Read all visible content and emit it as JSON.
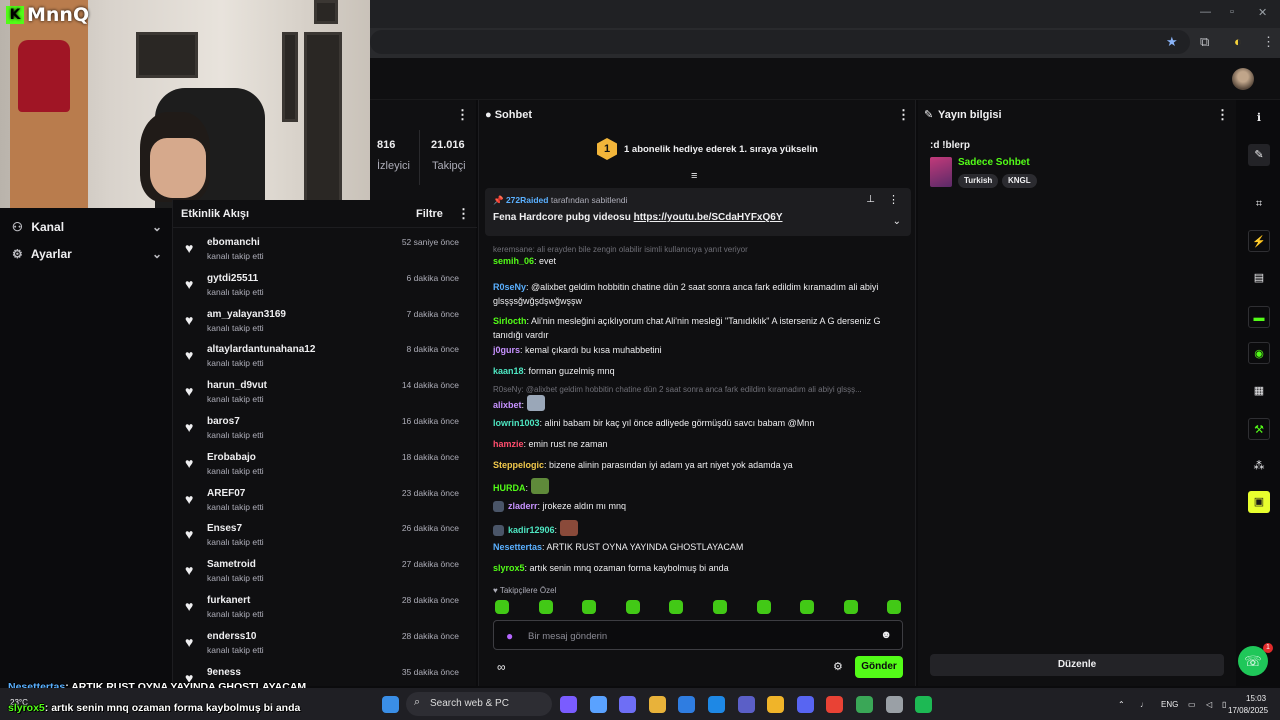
{
  "brand": {
    "logo_text": "MnnQ"
  },
  "stats": {
    "viewers_value": "816",
    "viewers_label": "İzleyici",
    "followers_value": "21.016",
    "followers_label": "Takipçi"
  },
  "left_nav": {
    "items": [
      {
        "label": "Kanal",
        "icon": "user-icon"
      },
      {
        "label": "Ayarlar",
        "icon": "gear-icon"
      }
    ]
  },
  "activity": {
    "title": "Etkinlik Akışı",
    "filter_label": "Filtre",
    "items": [
      {
        "user": "ebomanchi",
        "action": "kanalı takip etti",
        "time": "52 saniye önce"
      },
      {
        "user": "gytdi25511",
        "action": "kanalı takip etti",
        "time": "6 dakika önce"
      },
      {
        "user": "am_yalayan3169",
        "action": "kanalı takip etti",
        "time": "7 dakika önce"
      },
      {
        "user": "altaylardantunahana12",
        "action": "kanalı takip etti",
        "time": "8 dakika önce"
      },
      {
        "user": "harun_d9vut",
        "action": "kanalı takip etti",
        "time": "14 dakika önce"
      },
      {
        "user": "baros7",
        "action": "kanalı takip etti",
        "time": "16 dakika önce"
      },
      {
        "user": "Erobabajo",
        "action": "kanalı takip etti",
        "time": "18 dakika önce"
      },
      {
        "user": "AREF07",
        "action": "kanalı takip etti",
        "time": "23 dakika önce"
      },
      {
        "user": "Enses7",
        "action": "kanalı takip etti",
        "time": "26 dakika önce"
      },
      {
        "user": "Sametroid",
        "action": "kanalı takip etti",
        "time": "27 dakika önce"
      },
      {
        "user": "furkanert",
        "action": "kanalı takip etti",
        "time": "28 dakika önce"
      },
      {
        "user": "enderss10",
        "action": "kanalı takip etti",
        "time": "28 dakika önce"
      },
      {
        "user": "9eness",
        "action": "",
        "time": "35 dakika önce"
      }
    ]
  },
  "chat": {
    "title": "Sohbet",
    "goal_badge": "1",
    "goal_text": "1 abonelik hediye ederek 1. sıraya yükselin",
    "pinned": {
      "user": "272Raided",
      "meta_suffix": "tarafından sabitlendi",
      "text": "Fena Hardcore pubg videosu",
      "link": "https://youtu.be/SCdaHYFxQ6Y"
    },
    "reply_1": "keremsane: ali erayden bile zengin olabilir isimli kullanıcıya yanıt veriyor",
    "reply_2": "R0seNy: @alixbet geldim hobbitin chatine dün 2 saat sonra anca fark edildim kıramadım ali abiyi glsşş...",
    "messages": [
      {
        "user": "semih_06",
        "color": "#53fc18",
        "text": "evet"
      },
      {
        "user": "R0seNy",
        "color": "#5ab0ff",
        "text": "@alixbet geldim hobbitin chatine dün 2 saat sonra anca fark edildim kıramadım ali abiyi glsşşsğwğşdşwğwşşw"
      },
      {
        "user": "Sirlocth",
        "color": "#53fc18",
        "text": "Ali'nin mesleğini açıklıyorum chat Ali'nin mesleği \"Tanıdıklık\" A isterseniz A G derseniz G tanıdığı vardır"
      },
      {
        "user": "j0gurs",
        "color": "#c792ff",
        "text": "kemal çıkardı bu kısa muhabbetini"
      },
      {
        "user": "kaan18",
        "color": "#4ee6c2",
        "text": "forman guzelmiş mnq"
      },
      {
        "user": "alixbet",
        "color": "#c792ff",
        "text": ""
      },
      {
        "user": "lowrin1003",
        "color": "#4ee6c2",
        "text": "alini babam bir kaç yıl önce adliyede görmüşdü savcı babam @Mnn"
      },
      {
        "user": "hamzie",
        "color": "#ff4d6d",
        "text": "emin rust ne zaman"
      },
      {
        "user": "Steppelogic",
        "color": "#f2c94c",
        "text": "bizene alinin parasından iyi adam ya art niyet yok adamda ya"
      },
      {
        "user": "HURDA",
        "color": "#53fc18",
        "text": ""
      },
      {
        "user": "zladerr",
        "color": "#c792ff",
        "text": "jrokeze aldın mı mnq"
      },
      {
        "user": "kadir12906",
        "color": "#4ee6c2",
        "text": ""
      },
      {
        "user": "Nesettertas",
        "color": "#5ab0ff",
        "text": "ARTIK RUST OYNA YAYINDA GHOSTLAYACAM"
      },
      {
        "user": "slyrox5",
        "color": "#53fc18",
        "text": "artık senin mnq ozaman forma kaybolmuş bi anda"
      }
    ],
    "followers_only": "Takipçilere Özel",
    "input_placeholder": "Bir mesaj gönderin",
    "send_label": "Gönder"
  },
  "stream_info": {
    "title": "Yayın bilgisi",
    "stream_title": ":d !blerp",
    "category": "Sadece Sohbet",
    "tags": [
      "Turkish",
      "KNGL"
    ],
    "edit_label": "Düzenle"
  },
  "overlay": {
    "line1_user": "Nesettertas",
    "line1_text": ": ARTIK RUST OYNA YAYINDA GHOSTLAYACAM",
    "line2_user": "slyrox5",
    "line2_text": ": artık senin mnq ozaman forma kaybolmuş bi anda"
  },
  "taskbar": {
    "weather": "23°C",
    "search_placeholder": "Search web & PC",
    "lang": "ENG",
    "time": "15:03",
    "date": "17/08/2025"
  },
  "colors": {
    "accent": "#53fc18",
    "bg": "#0f0f11",
    "goal": "#f2b53a"
  }
}
